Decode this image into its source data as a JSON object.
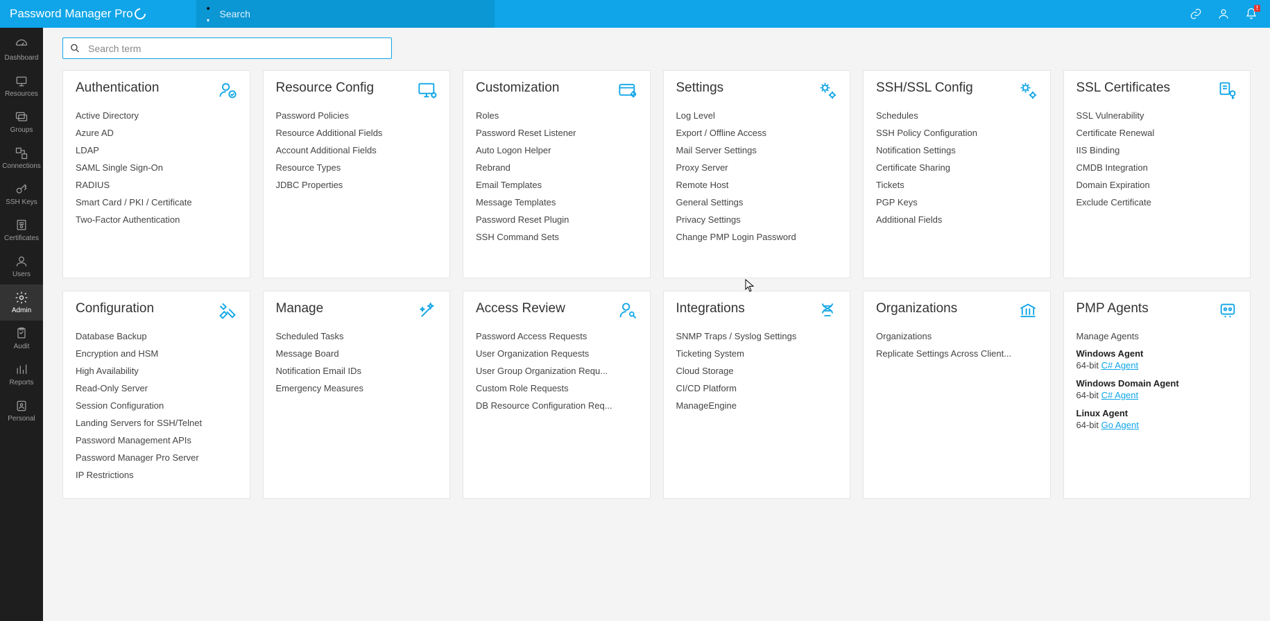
{
  "brand": "Password Manager Pro",
  "topsearch_placeholder": "Search",
  "termsearch_placeholder": "Search term",
  "sidebar": [
    {
      "id": "dashboard",
      "label": "Dashboard"
    },
    {
      "id": "resources",
      "label": "Resources"
    },
    {
      "id": "groups",
      "label": "Groups"
    },
    {
      "id": "connections",
      "label": "Connections"
    },
    {
      "id": "sshkeys",
      "label": "SSH Keys"
    },
    {
      "id": "certificates",
      "label": "Certificates"
    },
    {
      "id": "users",
      "label": "Users"
    },
    {
      "id": "admin",
      "label": "Admin",
      "active": true
    },
    {
      "id": "audit",
      "label": "Audit"
    },
    {
      "id": "reports",
      "label": "Reports"
    },
    {
      "id": "personal",
      "label": "Personal"
    }
  ],
  "cards": [
    {
      "id": "auth",
      "title": "Authentication",
      "icon": "user-check",
      "items": [
        "Active Directory",
        "Azure AD",
        "LDAP",
        "SAML Single Sign-On",
        "RADIUS",
        "Smart Card / PKI / Certificate",
        "Two-Factor Authentication"
      ]
    },
    {
      "id": "resconf",
      "title": "Resource Config",
      "icon": "monitor-gear",
      "items": [
        "Password Policies",
        "Resource Additional Fields",
        "Account Additional Fields",
        "Resource Types",
        "JDBC Properties"
      ]
    },
    {
      "id": "custom",
      "title": "Customization",
      "icon": "card-gear",
      "items": [
        "Roles",
        "Password Reset Listener",
        "Auto Logon Helper",
        "Rebrand",
        "Email Templates",
        "Message Templates",
        "Password Reset Plugin",
        "SSH Command Sets"
      ]
    },
    {
      "id": "settings",
      "title": "Settings",
      "icon": "gears",
      "items": [
        "Log Level",
        "Export / Offline Access",
        "Mail Server Settings",
        "Proxy Server",
        "Remote Host",
        "General Settings",
        "Privacy Settings",
        "Change PMP Login Password"
      ]
    },
    {
      "id": "sshssl",
      "title": "SSH/SSL Config",
      "icon": "gears",
      "items": [
        "Schedules",
        "SSH Policy Configuration",
        "Notification Settings",
        "Certificate Sharing",
        "Tickets",
        "PGP Keys",
        "Additional Fields"
      ]
    },
    {
      "id": "sslcert",
      "title": "SSL Certificates",
      "icon": "cert-key",
      "items": [
        "SSL Vulnerability",
        "Certificate Renewal",
        "IIS Binding",
        "CMDB Integration",
        "Domain Expiration",
        "Exclude Certificate"
      ]
    },
    {
      "id": "config",
      "title": "Configuration",
      "icon": "tools",
      "items": [
        "Database Backup",
        "Encryption and HSM",
        "High Availability",
        "Read-Only Server",
        "Session Configuration",
        "Landing Servers for SSH/Telnet",
        "Password Management APIs",
        "Password Manager Pro Server",
        "IP Restrictions"
      ]
    },
    {
      "id": "manage",
      "title": "Manage",
      "icon": "wand",
      "items": [
        "Scheduled Tasks",
        "Message Board",
        "Notification Email IDs",
        "Emergency Measures"
      ]
    },
    {
      "id": "access",
      "title": "Access Review",
      "icon": "user-key",
      "items": [
        "Password Access Requests",
        "User Organization Requests",
        "User Group Organization Requ...",
        "Custom Role Requests",
        "DB Resource Configuration Req..."
      ]
    },
    {
      "id": "integ",
      "title": "Integrations",
      "icon": "dna",
      "items": [
        "SNMP Traps / Syslog Settings",
        "Ticketing System",
        "Cloud Storage",
        "CI/CD Platform",
        "ManageEngine"
      ]
    },
    {
      "id": "orgs",
      "title": "Organizations",
      "icon": "bank",
      "items": [
        "Organizations",
        "Replicate Settings Across Client..."
      ]
    },
    {
      "id": "agents",
      "title": "PMP Agents",
      "icon": "agent",
      "agent": true,
      "manage_label": "Manage Agents",
      "groups": [
        {
          "title": "Windows Agent",
          "arch": "64-bit",
          "link": "C# Agent"
        },
        {
          "title": "Windows Domain Agent",
          "arch": "64-bit",
          "link": "C# Agent"
        },
        {
          "title": "Linux Agent",
          "arch": "64-bit",
          "link": "Go Agent"
        }
      ]
    }
  ]
}
